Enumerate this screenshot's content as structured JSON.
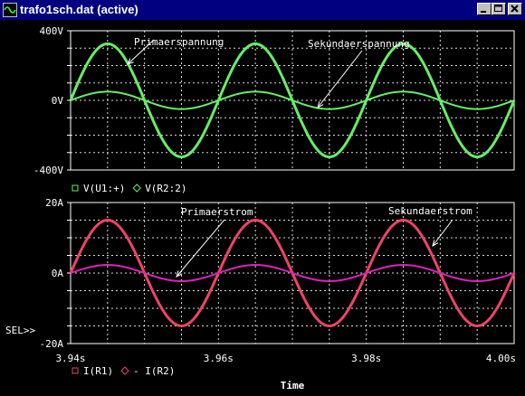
{
  "window": {
    "title": "trafo1sch.dat (active)",
    "buttons": {
      "minimize": "minimize-icon",
      "maximize": "maximize-icon",
      "close": "close-icon"
    }
  },
  "colors": {
    "background": "#000000",
    "grid": "#ffffff",
    "text": "#ffffff",
    "voltage_series": "#66ee66",
    "current_primary": "#ee4466",
    "current_secondary": "#dd22bb",
    "titlebar": "#000080"
  },
  "chart_data": [
    {
      "type": "line",
      "x_range": [
        3.94,
        4.0
      ],
      "y_range": [
        -400,
        400
      ],
      "y_ticks": [
        400,
        0,
        -400
      ],
      "y_tick_labels": [
        "400V",
        "0V",
        "-400V"
      ],
      "grid": true,
      "legend": [
        {
          "label": "V(U1:+)",
          "color": "#66ee66",
          "marker": "square"
        },
        {
          "label": "V(R2:2)",
          "color": "#66ee66",
          "marker": "diamond"
        }
      ],
      "series": [
        {
          "name": "V(U1:+)",
          "waveform": "sine",
          "amplitude": 325,
          "frequency_hz": 50,
          "phase_deg": 0
        },
        {
          "name": "V(R2:2)",
          "waveform": "sine",
          "amplitude": 50,
          "frequency_hz": 50,
          "phase_deg": 0
        }
      ],
      "annotations": [
        {
          "text": "Primaerspannung",
          "points_to": "V(U1:+)"
        },
        {
          "text": "Sekundaerspannung",
          "points_to": "V(R2:2)"
        }
      ]
    },
    {
      "type": "line",
      "x_range": [
        3.94,
        4.0
      ],
      "y_range": [
        -20,
        20
      ],
      "y_ticks": [
        20,
        0,
        -20
      ],
      "y_tick_labels": [
        "20A",
        "0A",
        "-20A"
      ],
      "x_ticks": [
        3.94,
        3.96,
        3.98,
        4.0
      ],
      "x_tick_labels": [
        "3.94s",
        "3.96s",
        "3.98s",
        "4.00s"
      ],
      "xlabel": "Time",
      "grid": true,
      "selection_marker": "SEL>>",
      "legend": [
        {
          "label": "I(R1)",
          "color": "#ee4466",
          "marker": "square"
        },
        {
          "label": "- I(R2)",
          "color": "#ee4466",
          "marker": "diamond"
        }
      ],
      "series": [
        {
          "name": "I(R1)",
          "waveform": "sine",
          "amplitude": 15,
          "frequency_hz": 50,
          "phase_deg": 0
        },
        {
          "name": "- I(R2)",
          "waveform": "sine",
          "amplitude": 2.3,
          "frequency_hz": 50,
          "phase_deg": 0
        }
      ],
      "annotations": [
        {
          "text": "Primaerstrom",
          "points_to": "- I(R2)"
        },
        {
          "text": "Sekundaerstrom",
          "points_to": "I(R1)"
        }
      ]
    }
  ]
}
